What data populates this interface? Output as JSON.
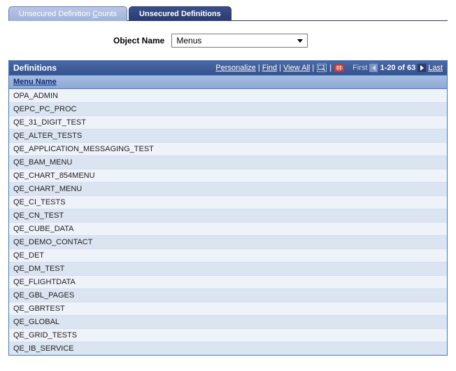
{
  "tabs": {
    "inactive_pre": "Unsecured Definition ",
    "inactive_hotkey": "C",
    "inactive_post": "ounts",
    "active": "Unsecured Definitions"
  },
  "filter": {
    "label": "Object Name",
    "value": "Menus"
  },
  "grid": {
    "title": "Definitions",
    "personalize": "Personalize",
    "find": "Find",
    "view_all": "View All",
    "first": "First",
    "range": "1-20 of 63",
    "last": "Last",
    "column": "Menu Name",
    "rows": [
      "OPA_ADMIN",
      "QEPC_PC_PROC",
      "QE_31_DIGIT_TEST",
      "QE_ALTER_TESTS",
      "QE_APPLICATION_MESSAGING_TEST",
      "QE_BAM_MENU",
      "QE_CHART_854MENU",
      "QE_CHART_MENU",
      "QE_CI_TESTS",
      "QE_CN_TEST",
      "QE_CUBE_DATA",
      "QE_DEMO_CONTACT",
      "QE_DET",
      "QE_DM_TEST",
      "QE_FLIGHTDATA",
      "QE_GBL_PAGES",
      "QE_GBRTEST",
      "QE_GLOBAL",
      "QE_GRID_TESTS",
      "QE_IB_SERVICE"
    ]
  }
}
